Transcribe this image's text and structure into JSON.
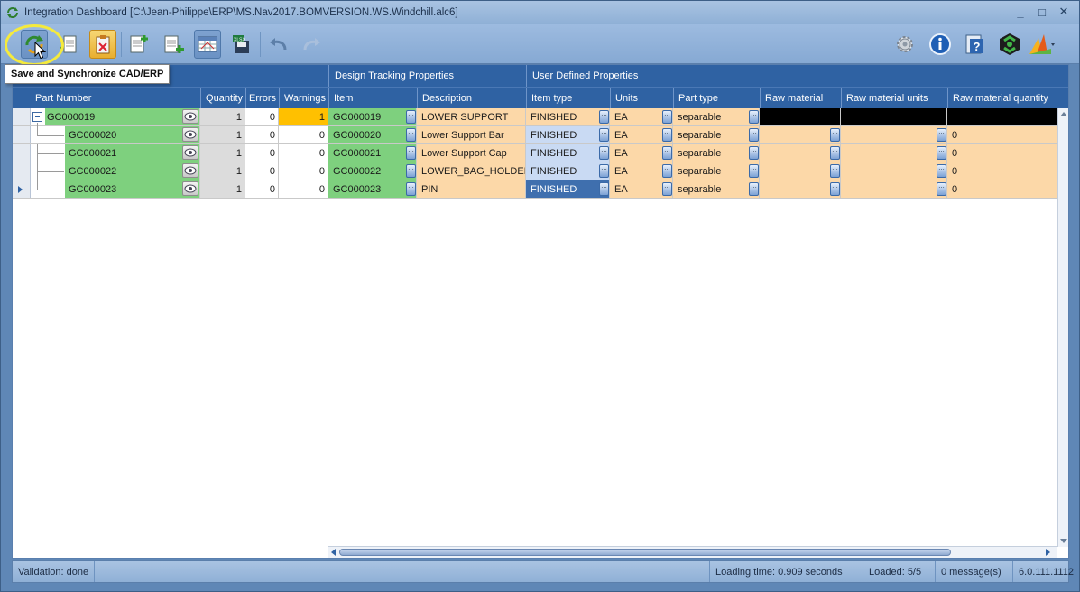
{
  "window": {
    "title": "Integration Dashboard [C:\\Jean-Philippe\\ERP\\MS.Nav2017.BOMVERSION.WS.Windchill.alc6]",
    "controls": [
      "_",
      "□",
      "✕"
    ]
  },
  "toolbar": {
    "tooltip": "Save and Synchronize CAD/ERP",
    "buttons": [
      "save-sync-icon",
      "compare-icon",
      "clipboard-icon",
      "add-document-icon",
      "add-list-icon",
      "grid-view-icon",
      "export-save-icon",
      "undo-icon",
      "redo-icon",
      "settings-icon",
      "info-icon",
      "help-icon",
      "logo-icon",
      "chart-icon"
    ]
  },
  "groups": {
    "design_tracking": "Design Tracking Properties",
    "user_defined": "User Defined Properties"
  },
  "columns": {
    "part_number": "Part Number",
    "quantity": "Quantity",
    "errors": "Errors",
    "warnings": "Warnings",
    "item": "Item",
    "description": "Description",
    "item_type": "Item type",
    "units": "Units",
    "part_type": "Part type",
    "raw_material": "Raw material",
    "raw_material_units": "Raw material units",
    "raw_material_quantity": "Raw material quantity"
  },
  "rows": [
    {
      "part": "GC000019",
      "qty": "1",
      "errors": "0",
      "warnings": "1",
      "item": "GC000019",
      "desc": "LOWER SUPPORT",
      "type": "FINISHED",
      "units": "EA",
      "ptype": "separable",
      "rmq": ""
    },
    {
      "part": "GC000020",
      "qty": "1",
      "errors": "0",
      "warnings": "0",
      "item": "GC000020",
      "desc": "Lower Support Bar",
      "type": "FINISHED",
      "units": "EA",
      "ptype": "separable",
      "rmq": "0"
    },
    {
      "part": "GC000021",
      "qty": "1",
      "errors": "0",
      "warnings": "0",
      "item": "GC000021",
      "desc": "Lower Support Cap",
      "type": "FINISHED",
      "units": "EA",
      "ptype": "separable",
      "rmq": "0"
    },
    {
      "part": "GC000022",
      "qty": "1",
      "errors": "0",
      "warnings": "0",
      "item": "GC000022",
      "desc": "LOWER_BAG_HOLDER",
      "type": "FINISHED",
      "units": "EA",
      "ptype": "separable",
      "rmq": "0"
    },
    {
      "part": "GC000023",
      "qty": "1",
      "errors": "0",
      "warnings": "0",
      "item": "GC000023",
      "desc": "PIN",
      "type": "FINISHED",
      "units": "EA",
      "ptype": "separable",
      "rmq": "0"
    }
  ],
  "status": {
    "validation": "Validation: done",
    "loading_time": "Loading time: 0.909 seconds",
    "loaded": "Loaded: 5/5",
    "messages": "0 message(s)",
    "version": "6.0.111.1112"
  }
}
